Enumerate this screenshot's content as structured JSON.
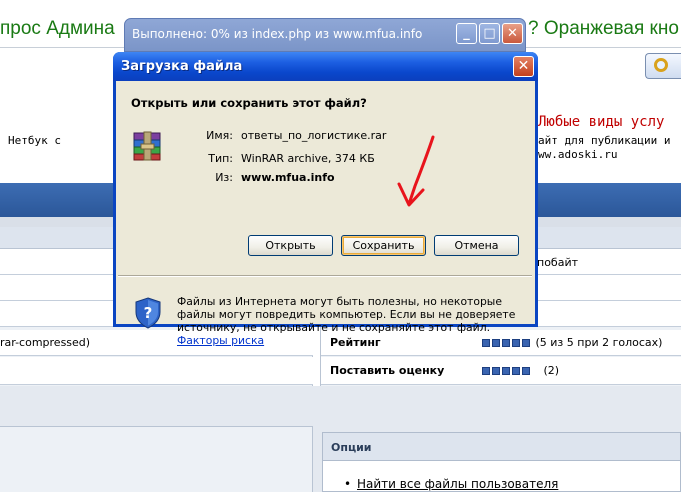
{
  "background": {
    "title_left": "прос Админа",
    "title_right": "? Оранжевая кно",
    "netbook": "Нетбук с",
    "ad_title": "Любые виды услу",
    "ad_line1": "айт для публикации и",
    "ad_line2": "ww.adoski.ru",
    "row_partial_right": "побайт",
    "row_partial_left": "rar-compressed)",
    "rating_label": "Рейтинг",
    "rating_value": "(5 из 5 при 2 голосах)",
    "rating_stars": 5,
    "rate_label": "Поставить оценку",
    "rate_value": "(2)",
    "options_title": "Опции",
    "options_link": "Найти все файлы пользователя"
  },
  "progress_window": {
    "title": "Выполнено: 0% из index.php из www.mfua.info",
    "buttons": [
      "minimize",
      "maximize",
      "close"
    ]
  },
  "dialog": {
    "title": "Загрузка файла",
    "question": "Открыть или сохранить этот файл?",
    "file_icon": "winrar-archive-icon",
    "name_label": "Имя:",
    "name_value": "ответы_по_логистике.rar",
    "type_label": "Тип:",
    "type_value": "WinRAR archive, 374 КБ",
    "from_label": "Из:",
    "from_value": "www.mfua.info",
    "open_button": "Открыть",
    "save_button": "Сохранить",
    "cancel_button": "Отмена",
    "warning_text": "Файлы из Интернета могут быть полезны, но некоторые файлы могут повредить компьютер. Если вы не доверяете источнику, не открывайте и не сохраняйте этот файл.",
    "warning_link": "Факторы риска",
    "warning_icon": "security-shield-question-icon"
  },
  "colors": {
    "title_green": "#1a7a14",
    "xp_title_blue": "#0a47cc",
    "dialog_face": "#ece9d8",
    "arrow_red": "#e8141c",
    "link_blue": "#0033cc"
  }
}
